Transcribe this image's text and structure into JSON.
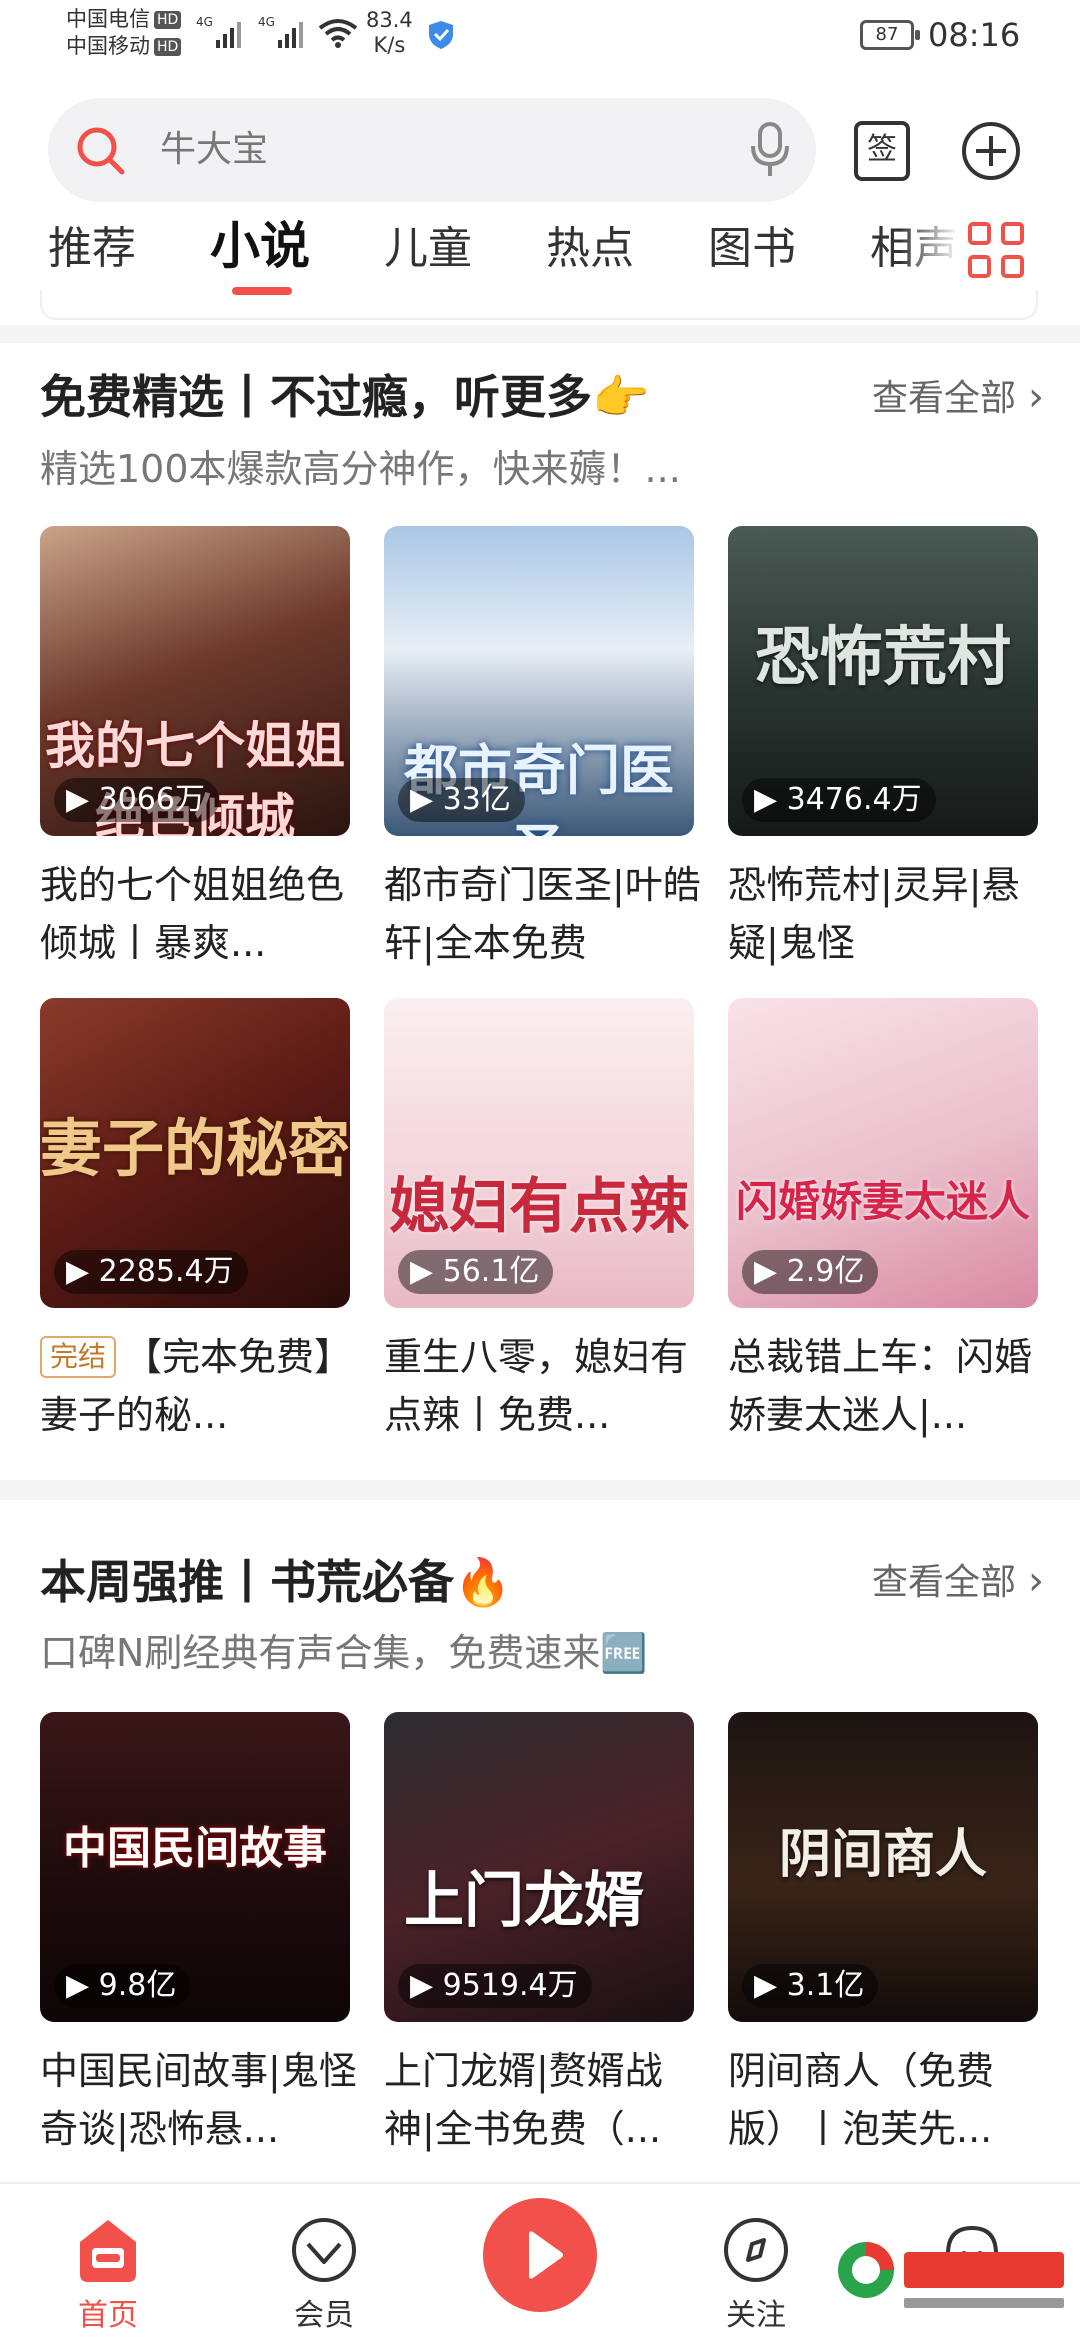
{
  "status": {
    "carrier1": "中国电信",
    "carrier2": "中国移动",
    "hd": "HD",
    "net1": "4G",
    "net2": "4G",
    "speed_value": "83.4",
    "speed_unit": "K/s",
    "battery": "87",
    "time": "08:16"
  },
  "search": {
    "placeholder": "牛大宝",
    "sign_label": "签"
  },
  "tabs": [
    "推荐",
    "小说",
    "儿童",
    "热点",
    "图书",
    "相声"
  ],
  "active_tab": "小说",
  "sections": [
    {
      "title": "免费精选丨不过瘾，听更多👉",
      "subtitle": "精选100本爆款高分神作，快来薅！...",
      "see_all": "查看全部",
      "books": [
        {
          "cover_text": "我的七个姐姐绝色倾城",
          "plays": "3066万",
          "title": "我的七个姐姐绝色倾城丨暴爽...",
          "done": ""
        },
        {
          "cover_text": "都市奇门医圣",
          "plays": "33亿",
          "title": "都市奇门医圣|叶皓轩|全本免费",
          "done": ""
        },
        {
          "cover_text": "恐怖荒村",
          "plays": "3476.4万",
          "title": "恐怖荒村|灵异|悬疑|鬼怪",
          "done": ""
        },
        {
          "cover_text": "妻子的秘密",
          "plays": "2285.4万",
          "title": "【完本免费】妻子的秘...",
          "done": "完结"
        },
        {
          "cover_text": "媳妇有点辣",
          "plays": "56.1亿",
          "title": "重生八零，媳妇有点辣丨免费...",
          "done": ""
        },
        {
          "cover_text": "闪婚娇妻太迷人",
          "plays": "2.9亿",
          "title": "总裁错上车：闪婚娇妻太迷人|...",
          "done": ""
        }
      ]
    },
    {
      "title": "本周强推丨书荒必备🔥",
      "subtitle": "口碑N刷经典有声合集，免费速来🆓",
      "see_all": "查看全部",
      "books": [
        {
          "cover_text": "中国民间故事",
          "plays": "9.8亿",
          "title": "中国民间故事|鬼怪奇谈|恐怖悬...",
          "done": ""
        },
        {
          "cover_text": "上门龙婿",
          "plays": "9519.4万",
          "title": "上门龙婿|赘婿战神|全书免费（...",
          "done": ""
        },
        {
          "cover_text": "阴间商人",
          "plays": "3.1亿",
          "title": "阴间商人（免费版）丨泡芙先...",
          "done": ""
        }
      ]
    }
  ],
  "nav": [
    "首页",
    "会员",
    "关注"
  ],
  "colors": {
    "accent": "#f2504a",
    "badge_done": "#c47a2c"
  }
}
